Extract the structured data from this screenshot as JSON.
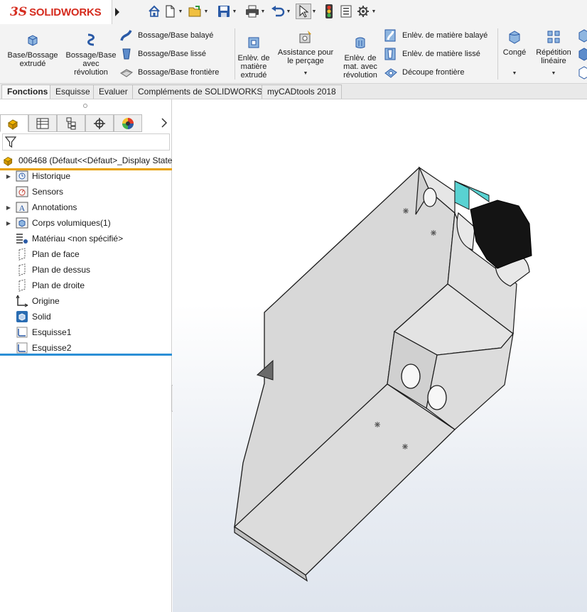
{
  "app": {
    "brand_prefix": "3S",
    "brand_name": "SOLIDWORKS"
  },
  "quick_access": {
    "icons": [
      "home-icon",
      "new-document-icon",
      "open-icon",
      "save-icon",
      "print-icon",
      "undo-icon",
      "select-icon",
      "rebuild-icon",
      "file-properties-icon",
      "options-icon"
    ]
  },
  "ribbon": {
    "base_bossage_extrude": "Base/Bossage\nextrudé",
    "bossage_revolution": "Bossage/Base\navec\nrévolution",
    "bossage_balaye": "Bossage/Base balayé",
    "bossage_lisse": "Bossage/Base lissé",
    "bossage_frontiere": "Bossage/Base frontière",
    "enlev_extrude": "Enlèv. de\nmatière\nextrudé",
    "assistance_percage": "Assistance pour\nle perçage",
    "enlev_revolution": "Enlèv. de\nmat. avec\nrévolution",
    "enlev_balaye": "Enlèv. de matière balayé",
    "enlev_lisse": "Enlèv. de matière lissé",
    "decoupe_frontiere": "Découpe frontière",
    "conge": "Congé",
    "repetition_lineaire": "Répétition\nlinéaire"
  },
  "tabs": [
    "Fonctions",
    "Esquisse",
    "Evaluer",
    "Compléments de SOLIDWORKS",
    "myCADtools 2018"
  ],
  "active_tab": "Fonctions",
  "feature_tree": {
    "root_label": "006468  (Défaut<<Défaut>_Display State",
    "items": [
      {
        "label": "Historique",
        "icon": "history-folder-icon",
        "expandable": true
      },
      {
        "label": "Sensors",
        "icon": "sensor-icon",
        "expandable": false
      },
      {
        "label": "Annotations",
        "icon": "annotations-icon",
        "expandable": true
      },
      {
        "label": "Corps volumiques(1)",
        "icon": "solid-bodies-icon",
        "expandable": true
      },
      {
        "label": "Matériau <non spécifié>",
        "icon": "material-icon",
        "expandable": false
      },
      {
        "label": "Plan de face",
        "icon": "plane-icon",
        "expandable": false
      },
      {
        "label": "Plan de dessus",
        "icon": "plane-icon",
        "expandable": false
      },
      {
        "label": "Plan de droite",
        "icon": "plane-icon",
        "expandable": false
      },
      {
        "label": "Origine",
        "icon": "origin-icon",
        "expandable": false
      },
      {
        "label": "Solid",
        "icon": "imported-solid-icon",
        "expandable": false
      },
      {
        "label": "Esquisse1",
        "icon": "sketch-icon",
        "expandable": false
      },
      {
        "label": "Esquisse2",
        "icon": "sketch-icon",
        "expandable": false
      }
    ]
  },
  "colors": {
    "brand": "#d52b1e",
    "root_underline": "#e8a000",
    "rollback_bar": "#2b8fd6",
    "model_face_light": "#e1e1e1",
    "model_face_mid": "#d3d3d3",
    "model_face_dark": "#bfbfbf",
    "knob": "#141414",
    "teal_accent": "#59d2d2"
  }
}
